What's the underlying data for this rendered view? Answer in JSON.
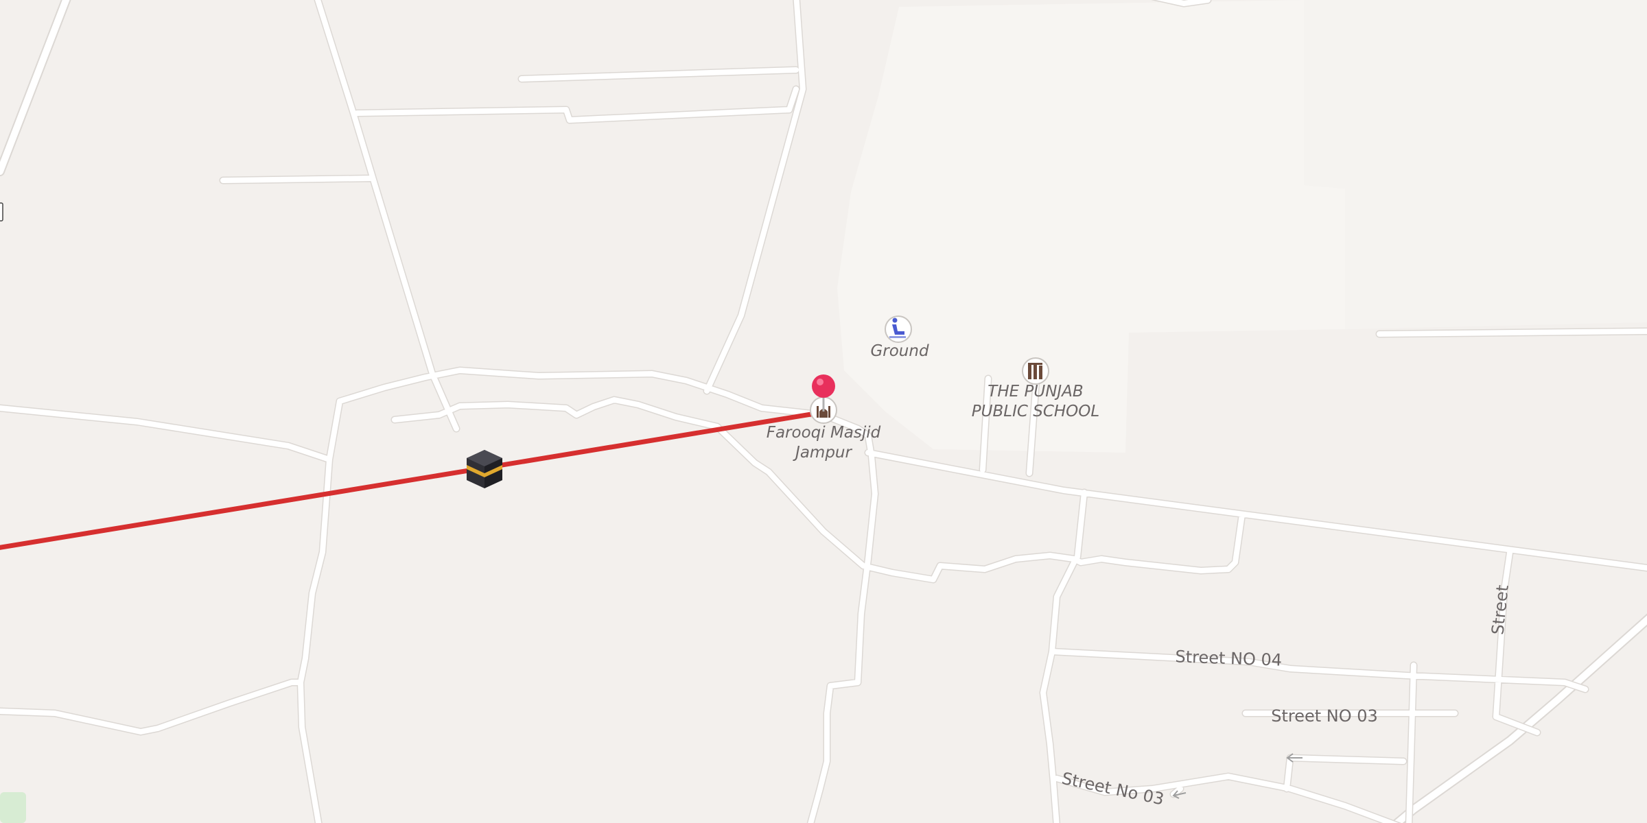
{
  "map": {
    "road_labels": {
      "street_no_04": "Street NO 04",
      "street_no_03_a": "Street NO 03",
      "street_no_03_b": "Street No 03",
      "street_vertical": "Street"
    },
    "pois": {
      "ground": {
        "name": "Ground",
        "icon": "sports-ground-icon"
      },
      "school": {
        "name_line1": "THE PUNJAB",
        "name_line2": "PUBLIC SCHOOL",
        "icon": "school-icon"
      },
      "masjid": {
        "name_line1": "Farooqi Masjid",
        "name_line2": "Jampur",
        "icon": "mosque-icon"
      }
    },
    "markers": {
      "location_pin": "location-pin-icon",
      "kaaba": "kaaba-icon"
    },
    "qibla_line": {
      "color": "#d62f2f"
    },
    "colors": {
      "background": "#f3f0ed",
      "campus": "#f7f5f2",
      "major_road": "#fde293",
      "major_road_casing": "#f0c36d",
      "pin": "#e8305c",
      "park": "#d7ecd3"
    }
  }
}
